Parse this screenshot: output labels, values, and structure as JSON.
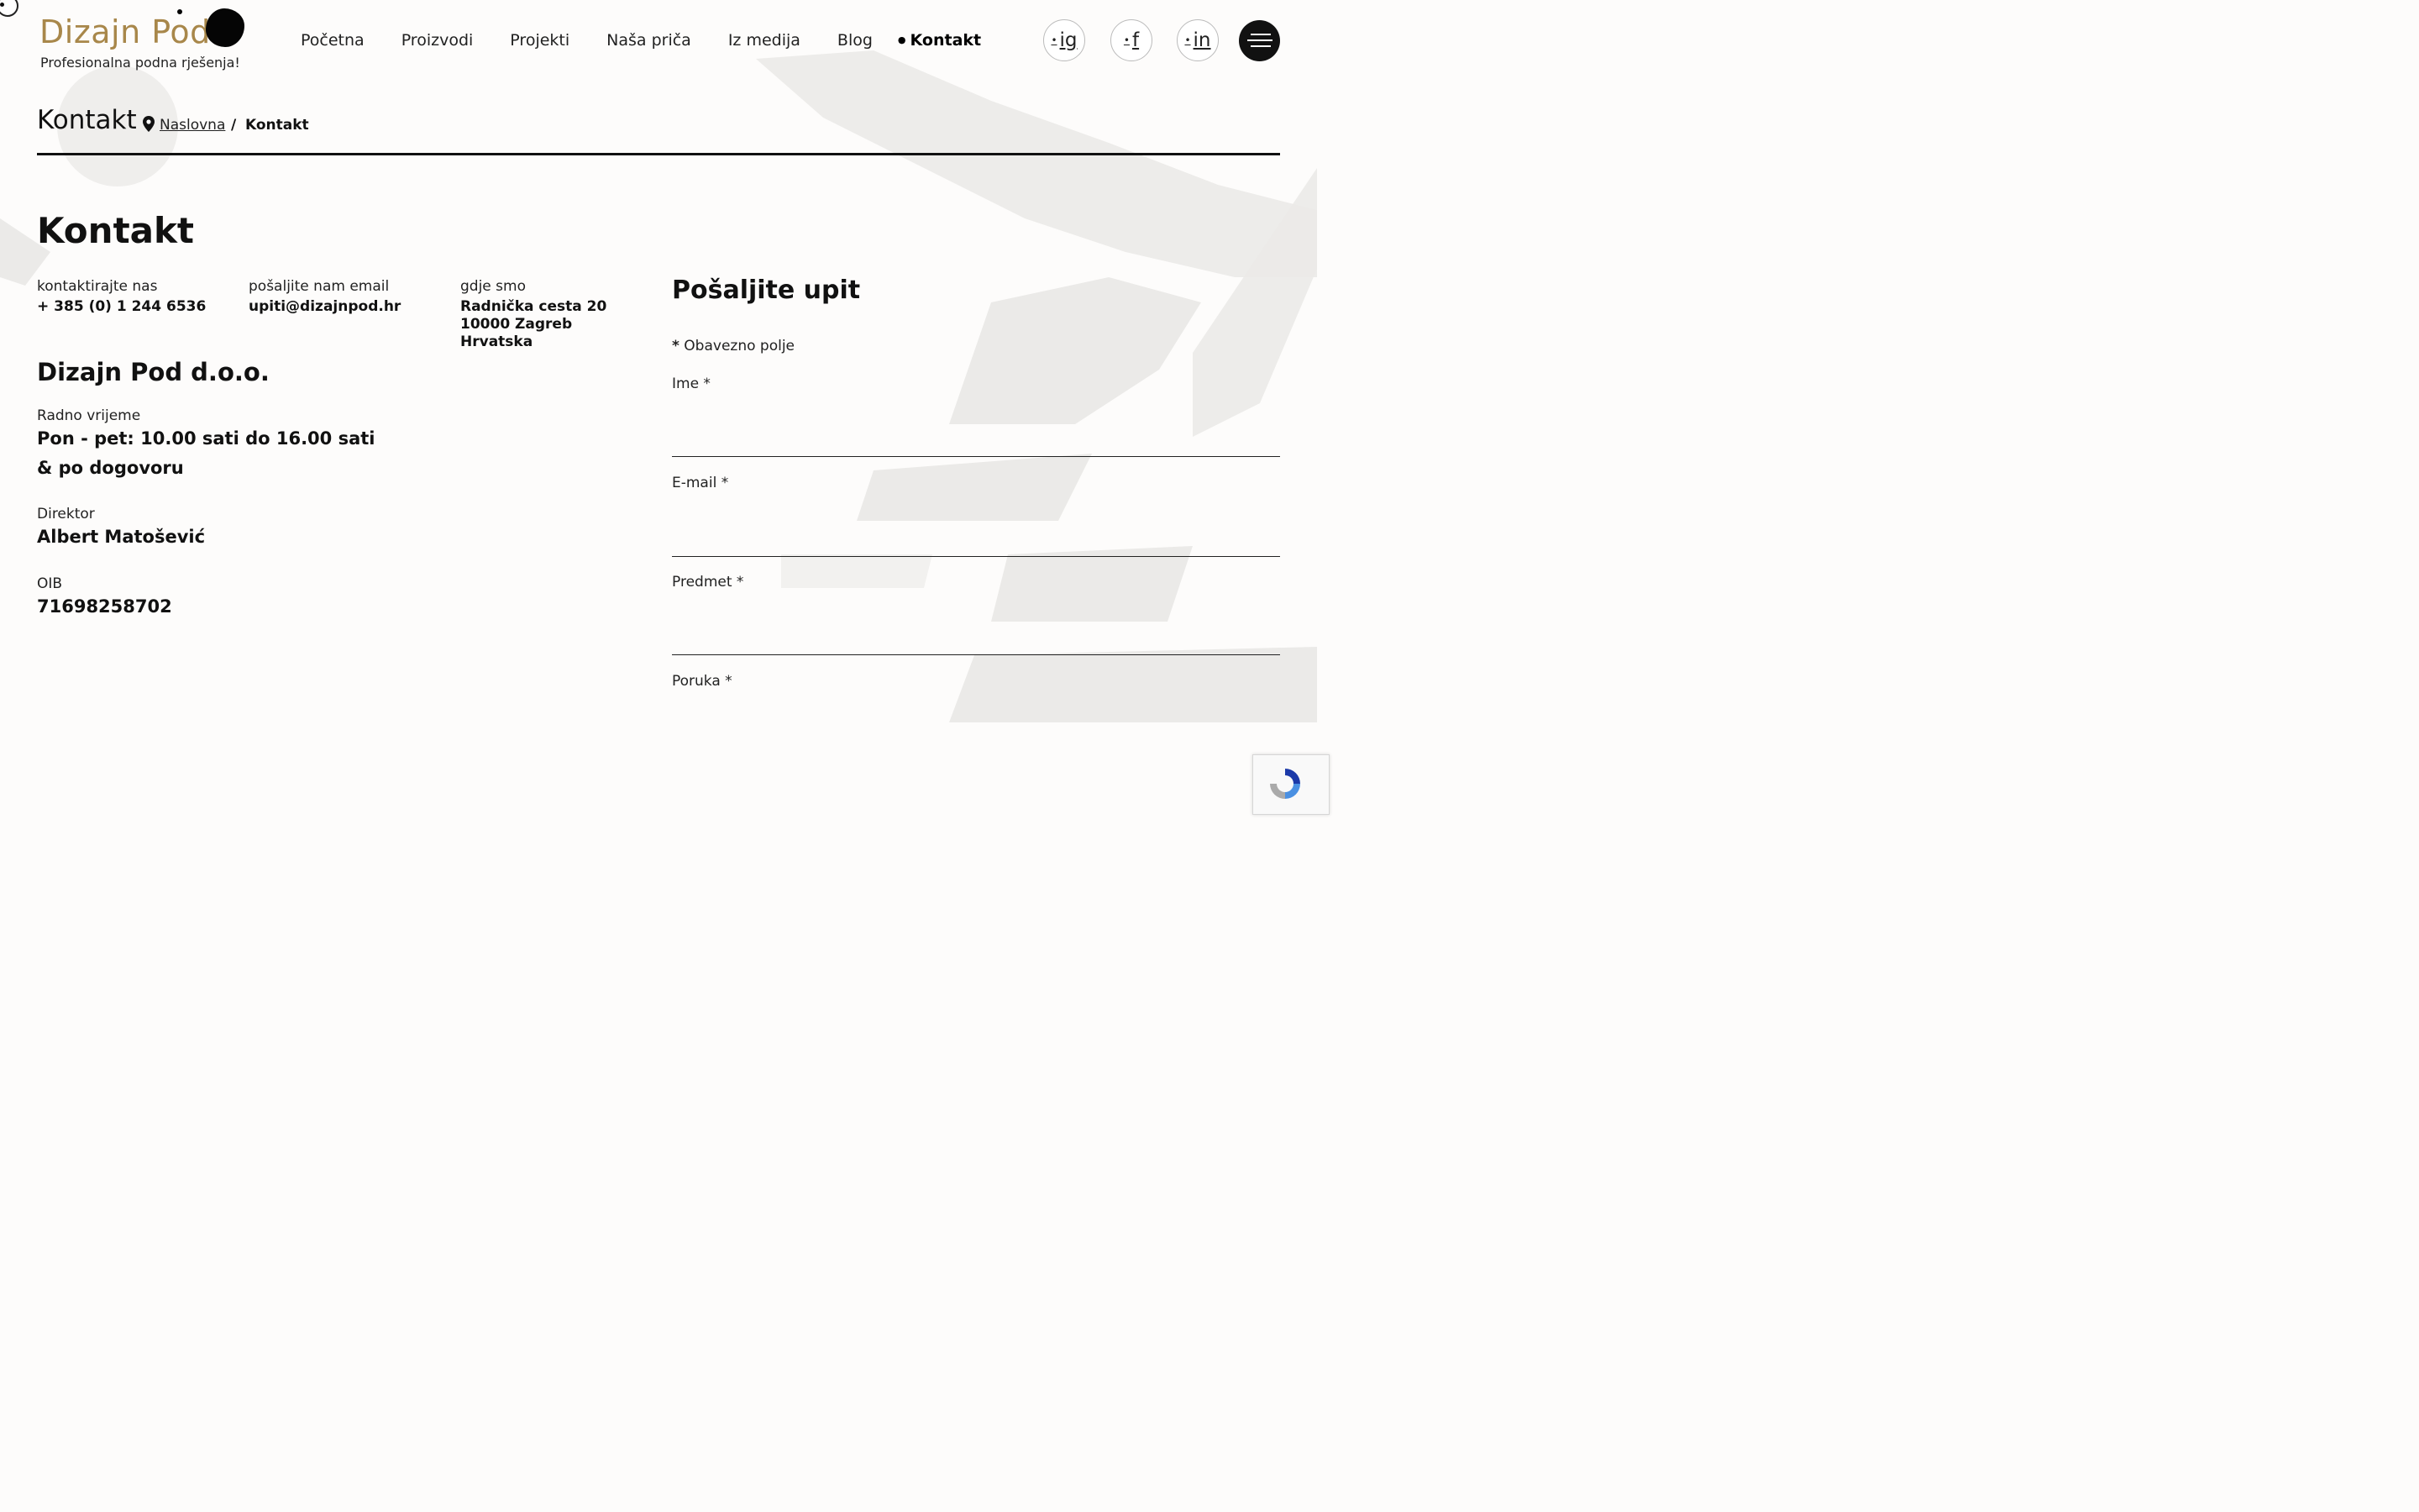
{
  "brand": {
    "name": "Dizajn Pod",
    "tagline": "Profesionalna podna rješenja!"
  },
  "nav": {
    "items": [
      {
        "label": "Početna"
      },
      {
        "label": "Proizvodi"
      },
      {
        "label": "Projekti"
      },
      {
        "label": "Naša priča"
      },
      {
        "label": "Iz medija"
      },
      {
        "label": "Blog"
      },
      {
        "label": "Kontakt",
        "active": true
      }
    ]
  },
  "social": {
    "instagram": "ig",
    "facebook": "f",
    "linkedin": "in"
  },
  "breadcrumb": {
    "title": "Kontakt",
    "home": "Naslovna",
    "separator": "/",
    "current": "Kontakt"
  },
  "contact": {
    "title": "Kontakt",
    "phone_label": "kontaktirajte nas",
    "phone": "+ 385 (0) 1 244 6536",
    "email_label": "pošaljite nam email",
    "email": "upiti@dizajnpod.hr",
    "address_label": "gdje smo",
    "address_line1": "Radnička cesta 20",
    "address_line2": "10000 Zagreb",
    "address_line3": "Hrvatska",
    "company": "Dizajn Pod d.o.o.",
    "hours_label": "Radno vrijeme",
    "hours_line1": "Pon - pet: 10.00 sati do 16.00 sati",
    "hours_line2": "& po dogovoru",
    "director_label": "Direktor",
    "director": "Albert Matošević",
    "oib_label": "OIB",
    "oib": "71698258702"
  },
  "form": {
    "title": "Pošaljite upit",
    "required_note": "Obavezno polje",
    "required_mark": "*",
    "fields": [
      {
        "label": "Ime *"
      },
      {
        "label": "E-mail *"
      },
      {
        "label": "Predmet *"
      },
      {
        "label": "Poruka *"
      }
    ]
  },
  "colors": {
    "brand_gold": "#a8874a",
    "text": "#111111",
    "brush_stroke": "#e9e8e6"
  },
  "icons": [
    "location-pin-icon",
    "hamburger-menu-icon",
    "recaptcha-icon"
  ]
}
